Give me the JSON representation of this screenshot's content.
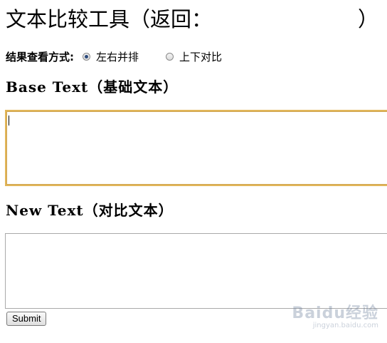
{
  "header": {
    "title": "文本比较工具（返回：",
    "title_close": "）"
  },
  "result_mode": {
    "label": "结果查看方式:",
    "options": [
      {
        "label": "左右并排",
        "selected": true
      },
      {
        "label": "上下对比",
        "selected": false
      }
    ]
  },
  "base_text": {
    "heading": "Base Text（基础文本）",
    "value": ""
  },
  "new_text": {
    "heading": "New Text（对比文本）",
    "value": ""
  },
  "form": {
    "submit_label": "Submit"
  },
  "watermark": {
    "text": "Baidu经验",
    "sub": "jingyan.baidu.com"
  },
  "colors": {
    "focus_border": "#e2b659",
    "border": "#a9a9a9",
    "radio_dot": "#2b4a7c"
  }
}
